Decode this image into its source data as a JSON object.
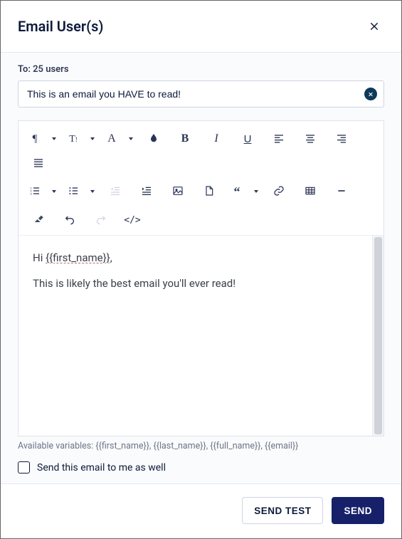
{
  "modal": {
    "title": "Email User(s)",
    "to_line": "To: 25 users",
    "subject": "This is an email you HAVE to read!",
    "body_line1_prefix": "Hi ",
    "body_line1_token": "{{first_name}}",
    "body_line1_suffix": ",",
    "body_line2": "This is likely the best email you'll ever read!",
    "available_vars_label": "Available variables: {{first_name}}, {{last_name}}, {{full_name}}, {{email}}",
    "send_copy_label": "Send this email to me as well",
    "send_copy_checked": false
  },
  "toolbar": {
    "row1": [
      {
        "name": "paragraph-format",
        "icon": "pilcrow",
        "dropdown": true
      },
      {
        "name": "text-transform",
        "icon": "text-height",
        "dropdown": true
      },
      {
        "name": "font-family",
        "icon": "letter-a",
        "dropdown": true
      },
      {
        "name": "text-color",
        "icon": "drop",
        "dropdown": false
      },
      {
        "name": "bold",
        "icon": "bold",
        "dropdown": false
      },
      {
        "name": "italic",
        "icon": "italic",
        "dropdown": false
      },
      {
        "name": "underline",
        "icon": "underline",
        "dropdown": false
      },
      {
        "name": "align-left",
        "icon": "align-left",
        "dropdown": false
      },
      {
        "name": "align-center",
        "icon": "align-center",
        "dropdown": false
      },
      {
        "name": "align-right",
        "icon": "align-right",
        "dropdown": false
      },
      {
        "name": "align-justify",
        "icon": "align-justify",
        "dropdown": false
      }
    ],
    "row2": [
      {
        "name": "ordered-list",
        "icon": "ordered-list",
        "dropdown": true
      },
      {
        "name": "unordered-list",
        "icon": "unordered-list",
        "dropdown": true
      },
      {
        "name": "outdent",
        "icon": "outdent",
        "dropdown": false,
        "disabled": true
      },
      {
        "name": "indent",
        "icon": "indent",
        "dropdown": false
      },
      {
        "name": "insert-image",
        "icon": "image",
        "dropdown": false
      },
      {
        "name": "insert-file",
        "icon": "file",
        "dropdown": false
      },
      {
        "name": "blockquote",
        "icon": "quote",
        "dropdown": true
      },
      {
        "name": "insert-link",
        "icon": "link",
        "dropdown": false
      },
      {
        "name": "insert-table",
        "icon": "table",
        "dropdown": false
      },
      {
        "name": "horizontal-rule",
        "icon": "minus",
        "dropdown": false
      }
    ],
    "row3": [
      {
        "name": "clear-formatting",
        "icon": "eraser",
        "dropdown": false
      },
      {
        "name": "undo",
        "icon": "undo",
        "dropdown": false
      },
      {
        "name": "redo",
        "icon": "redo",
        "dropdown": false,
        "disabled": true
      },
      {
        "name": "code-view",
        "icon": "code",
        "dropdown": false
      }
    ]
  },
  "footer": {
    "send_test_label": "SEND TEST",
    "send_label": "SEND"
  }
}
